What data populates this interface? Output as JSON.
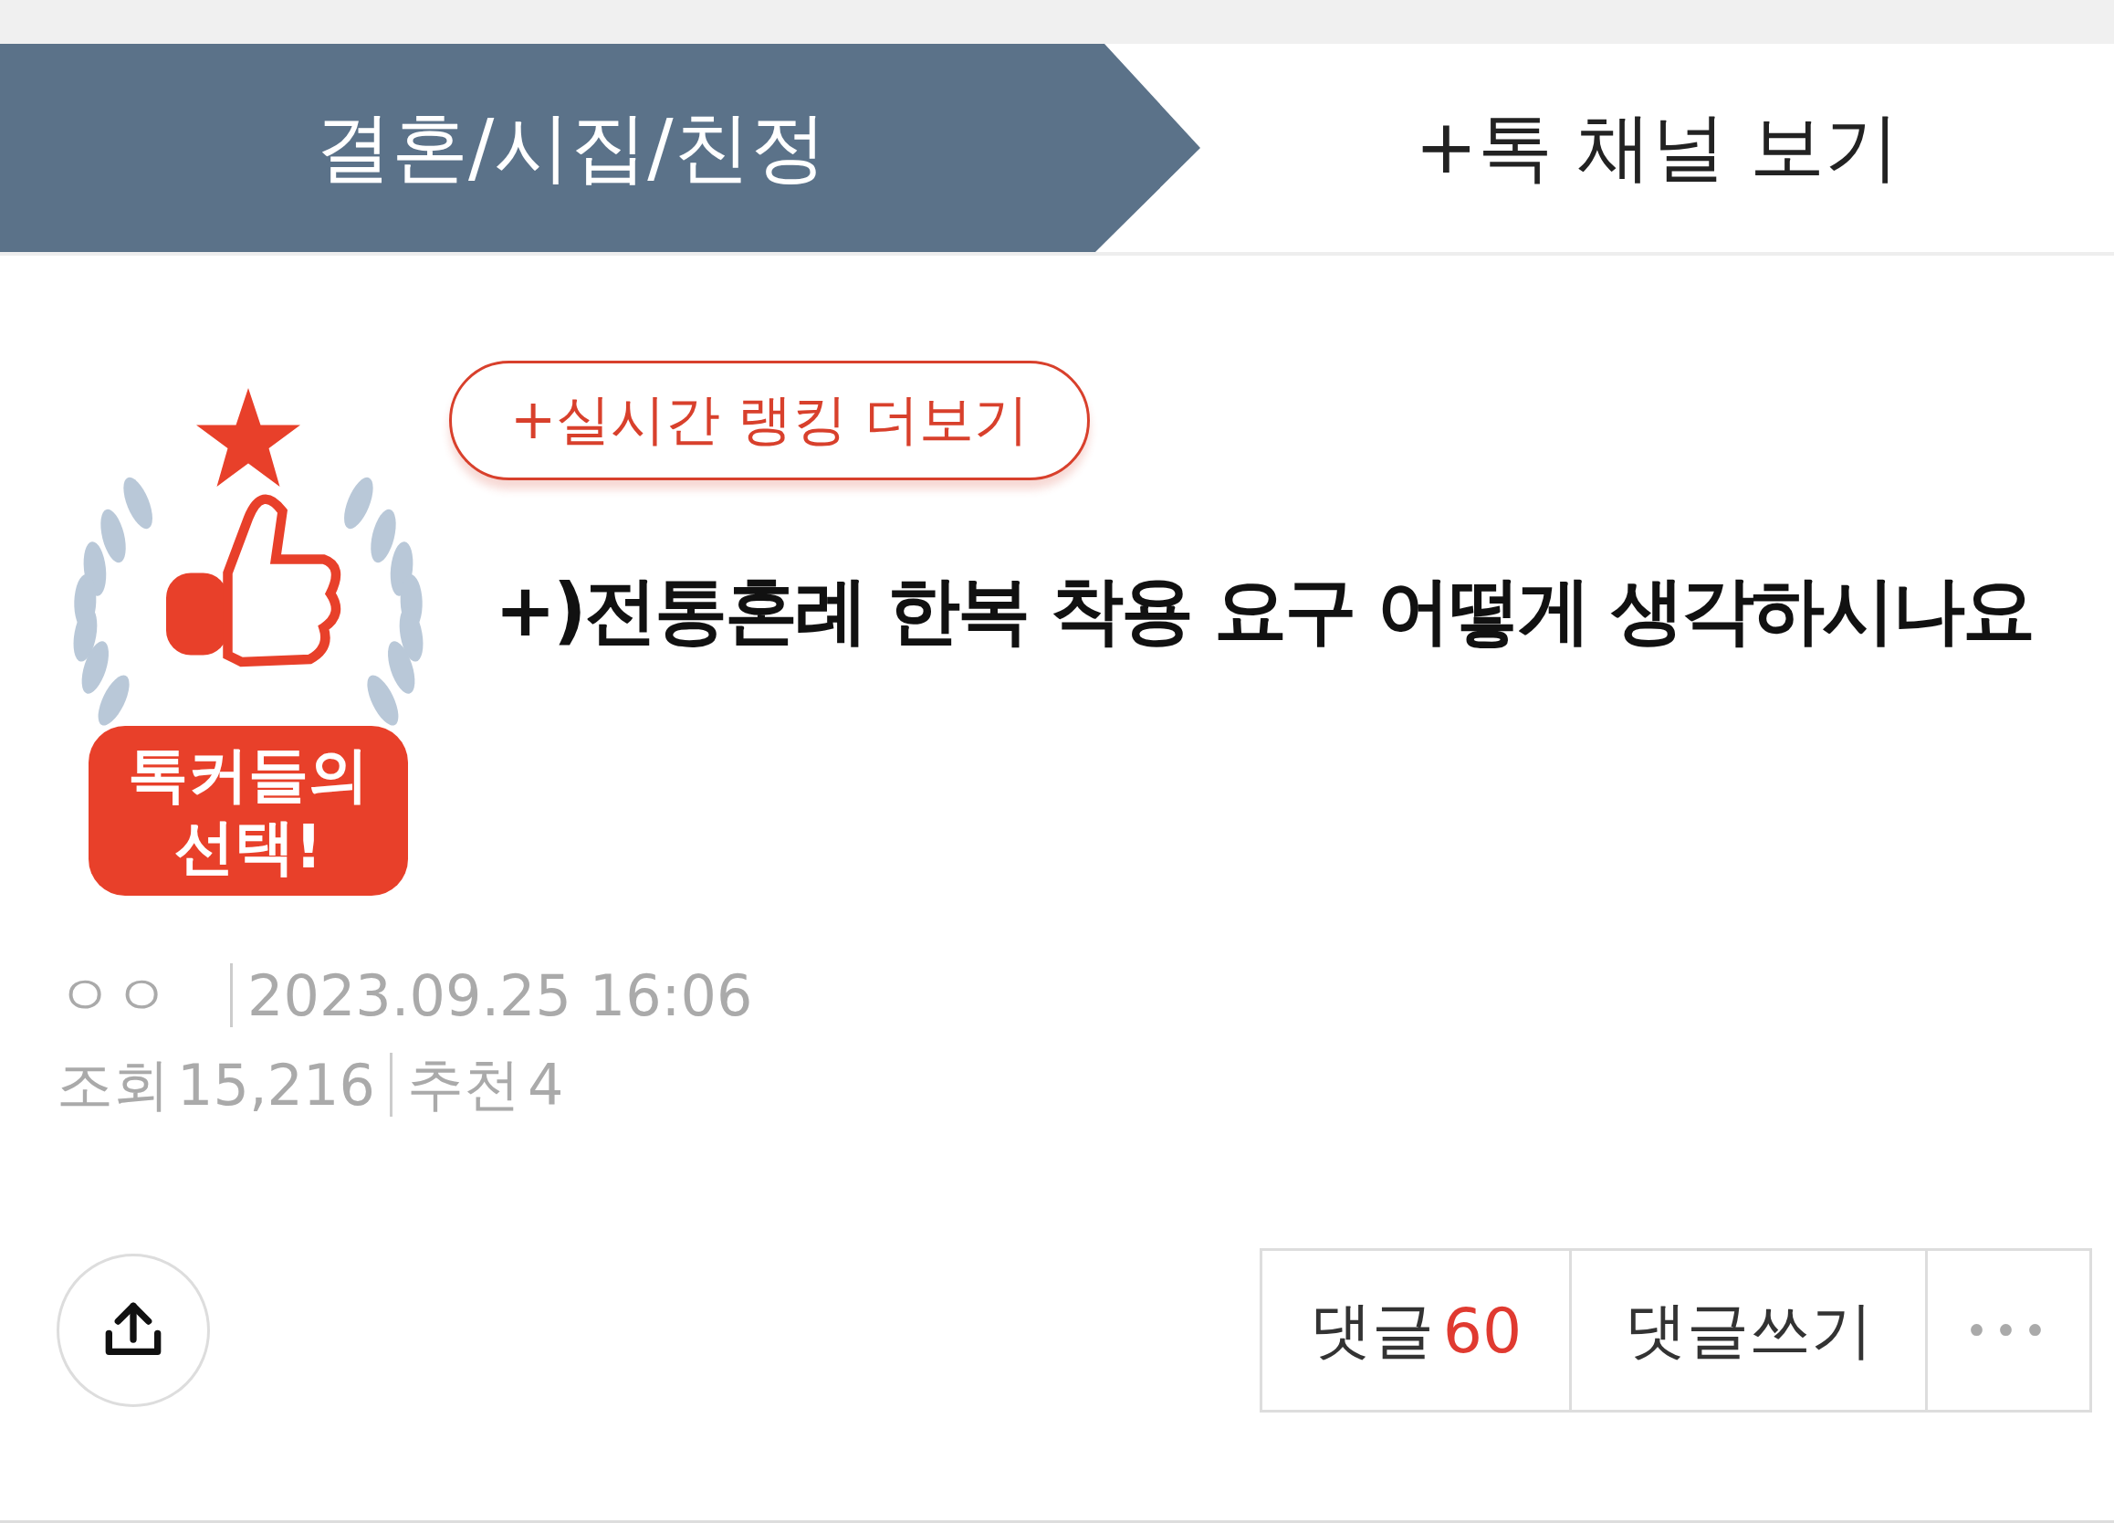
{
  "header": {
    "category": "결혼/시집/친정",
    "channel_link": "+톡 채널 보기"
  },
  "post": {
    "badge_text": "톡커들의 선택!",
    "ranking_button": "+실시간 랭킹 더보기",
    "title": "+)전통혼례 한복 착용 요구 어떻게 생각하시나요",
    "author": "ㅇㅇ",
    "date": "2023.09.25 16:06",
    "views_label": "조회",
    "views": "15,216",
    "likes_label": "추천",
    "likes": "4"
  },
  "actions": {
    "comments_label": "댓글",
    "comments_count": "60",
    "write_comment": "댓글쓰기",
    "more": "•••"
  }
}
